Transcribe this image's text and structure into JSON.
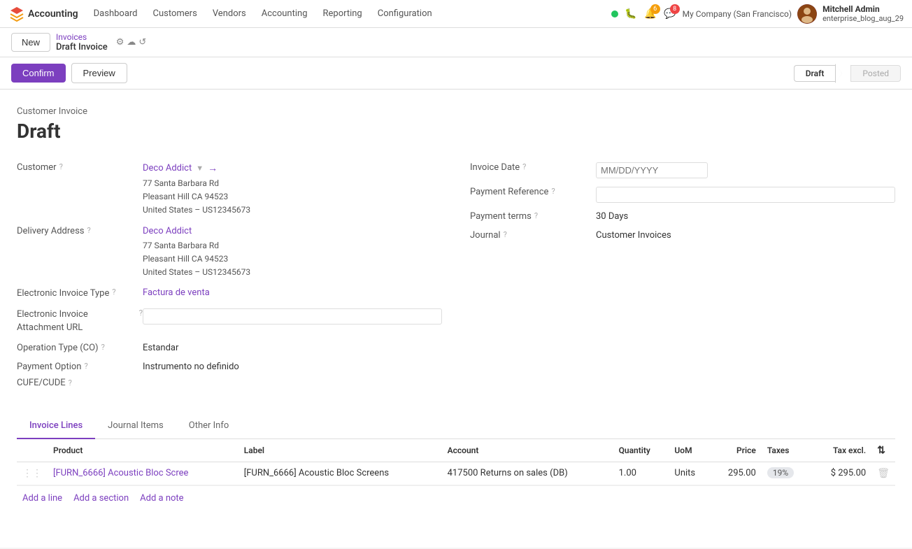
{
  "app": {
    "brand": "Accounting",
    "logo_unicode": "✳"
  },
  "topnav": {
    "items": [
      {
        "label": "Dashboard",
        "active": false
      },
      {
        "label": "Customers",
        "active": false
      },
      {
        "label": "Vendors",
        "active": false
      },
      {
        "label": "Accounting",
        "active": false
      },
      {
        "label": "Reporting",
        "active": false
      },
      {
        "label": "Configuration",
        "active": false
      }
    ],
    "right": {
      "company": "My Company (San Francisco)",
      "user_name": "Mitchell Admin",
      "user_sub": "enterprise_blog_aug_29",
      "notification_count": "6",
      "message_count": "8"
    }
  },
  "breadcrumb": {
    "parent": "Invoices",
    "current": "Draft Invoice",
    "icons": [
      "⚙",
      "☁",
      "↺"
    ]
  },
  "buttons": {
    "new": "New",
    "confirm": "Confirm",
    "preview": "Preview",
    "status_draft": "Draft",
    "status_posted": "Posted"
  },
  "form": {
    "invoice_type": "Customer Invoice",
    "invoice_status": "Draft",
    "left": {
      "customer_label": "Customer",
      "customer_value": "Deco Addict",
      "customer_address": "77 Santa Barbara Rd\nPleasant Hill CA 94523\nUnited States – US12345673",
      "delivery_label": "Delivery Address",
      "delivery_name": "Deco Addict",
      "delivery_address": "77 Santa Barbara Rd\nPleasant Hill CA 94523\nUnited States – US12345673",
      "electronic_invoice_type_label": "Electronic Invoice Type",
      "electronic_invoice_type_value": "Factura de venta",
      "electronic_invoice_attachment_label": "Electronic Invoice Attachment URL",
      "electronic_invoice_attachment_value": "",
      "operation_type_label": "Operation Type (CO)",
      "operation_type_value": "Estandar",
      "payment_option_label": "Payment Option",
      "payment_option_value": "Instrumento no definido",
      "cufe_label": "CUFE/CUDE"
    },
    "right": {
      "invoice_date_label": "Invoice Date",
      "invoice_date_value": "",
      "payment_reference_label": "Payment Reference",
      "payment_reference_value": "",
      "payment_terms_label": "Payment terms",
      "payment_terms_value": "30 Days",
      "journal_label": "Journal",
      "journal_value": "Customer Invoices"
    }
  },
  "tabs": [
    {
      "label": "Invoice Lines",
      "active": true
    },
    {
      "label": "Journal Items",
      "active": false
    },
    {
      "label": "Other Info",
      "active": false
    }
  ],
  "table": {
    "headers": [
      {
        "label": "",
        "key": "drag"
      },
      {
        "label": "Product",
        "key": "product"
      },
      {
        "label": "Label",
        "key": "label"
      },
      {
        "label": "Account",
        "key": "account"
      },
      {
        "label": "Quantity",
        "key": "quantity"
      },
      {
        "label": "UoM",
        "key": "uom"
      },
      {
        "label": "Price",
        "key": "price",
        "align": "right"
      },
      {
        "label": "Taxes",
        "key": "taxes"
      },
      {
        "label": "Tax excl.",
        "key": "tax_excl",
        "align": "right"
      },
      {
        "label": "⇅",
        "key": "actions"
      }
    ],
    "rows": [
      {
        "drag": "⋮⋮",
        "product": "[FURN_6666] Acoustic Bloc Scree",
        "label": "[FURN_6666] Acoustic Bloc Screens",
        "account": "417500 Returns on sales (DB)",
        "quantity": "1.00",
        "uom": "Units",
        "price": "295.00",
        "taxes": "19%",
        "tax_excl": "$ 295.00",
        "delete": "🗑"
      }
    ]
  },
  "footer": {
    "add_line": "Add a line",
    "add_section": "Add a section",
    "add_note": "Add a note"
  }
}
